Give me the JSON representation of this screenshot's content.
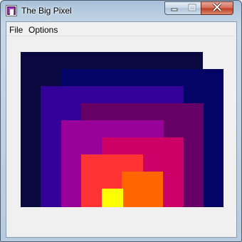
{
  "window": {
    "title": "The Big Pixel"
  },
  "menu": {
    "file": "File",
    "options": "Options"
  },
  "icons": {
    "app": "app-icon",
    "minimize": "minimize-icon",
    "maximize": "maximize-icon",
    "close": "close-icon"
  },
  "colors": {
    "rect1": "#090940",
    "rect2": "#040466",
    "rect3": "#330099",
    "rect4": "#660066",
    "rect5": "#990099",
    "rect6": "#cc0066",
    "rect7": "#ff3333",
    "rect8": "#ff6600",
    "rect9": "#ffff00"
  }
}
